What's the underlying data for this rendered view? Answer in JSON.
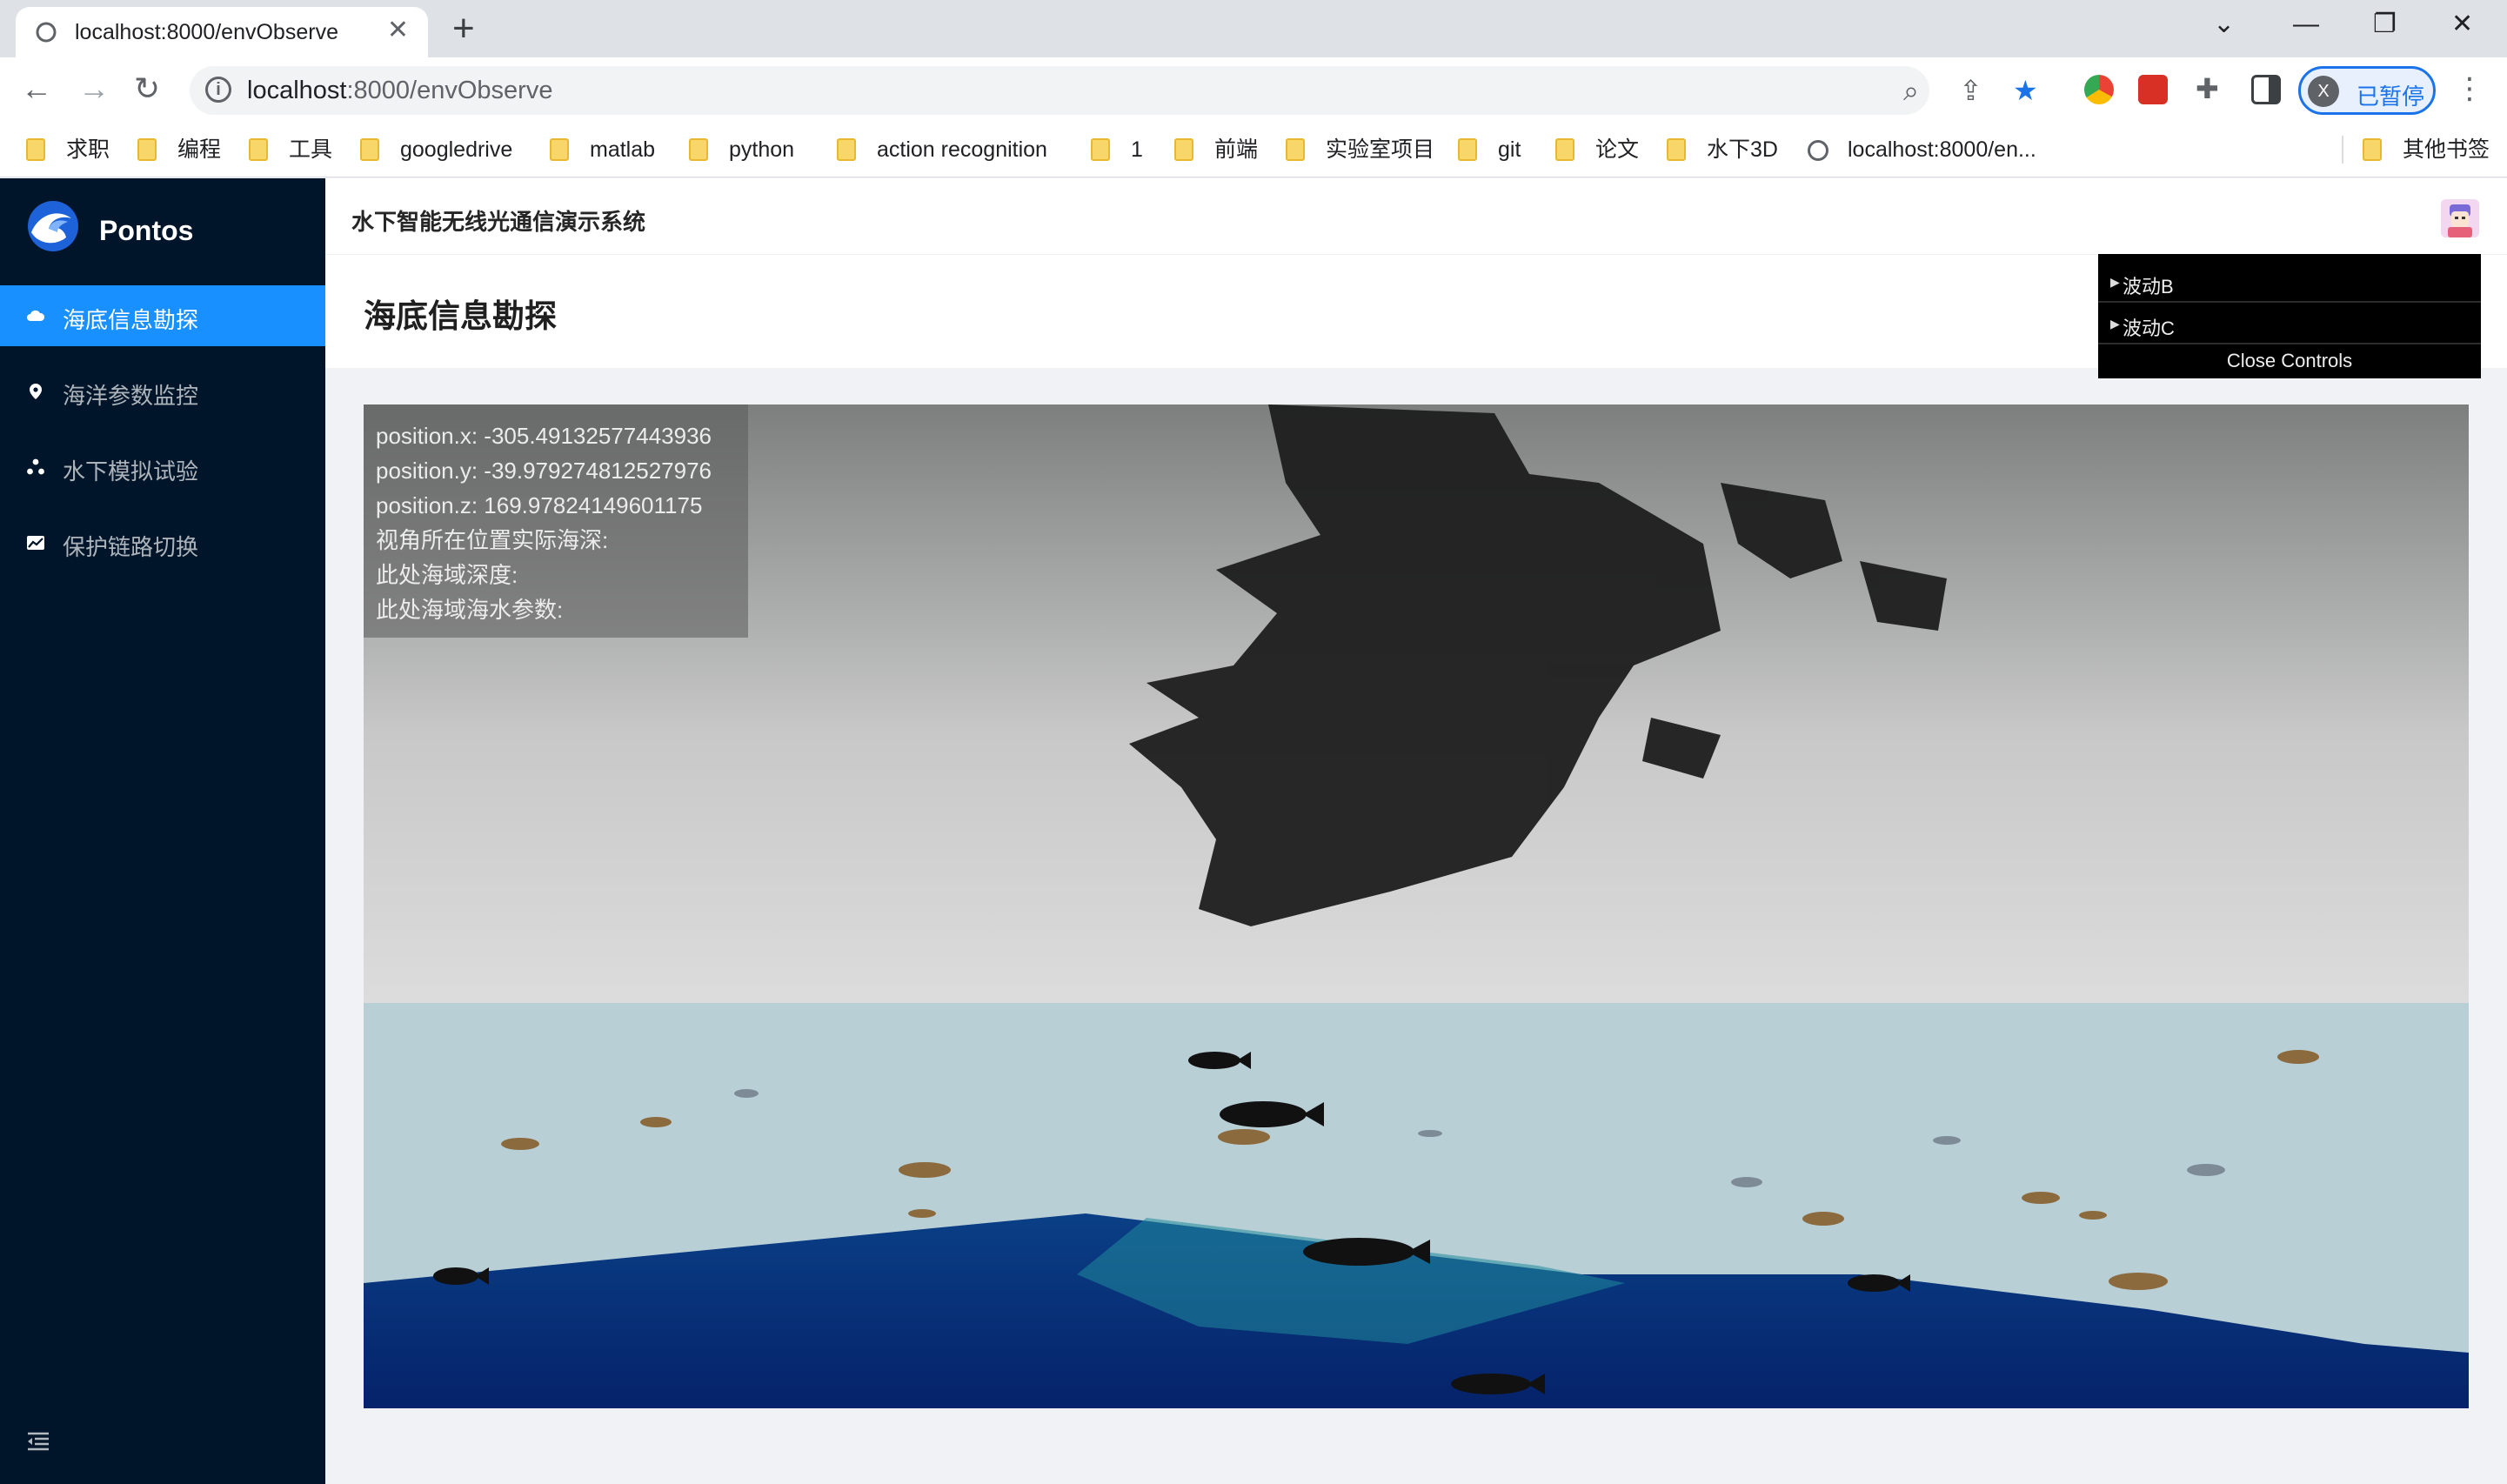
{
  "browser": {
    "tab_title": "localhost:8000/envObserve",
    "url_host": "localhost",
    "url_rest": ":8000/envObserve",
    "profile_initial": "X",
    "profile_label": "已暂停",
    "bookmarks": [
      "求职",
      "编程",
      "工具",
      "googledrive",
      "matlab",
      "python",
      "action recognition",
      "1",
      "前端",
      "实验室项目",
      "git",
      "论文",
      "水下3D",
      "localhost:8000/en...",
      "其他书签"
    ]
  },
  "app": {
    "brand": "Pontos",
    "header_title": "水下智能无线光通信演示系统",
    "page_title": "海底信息勘探",
    "menu": [
      {
        "label": "海底信息勘探",
        "icon": "cloud-icon",
        "active": true
      },
      {
        "label": "海洋参数监控",
        "icon": "location-pin-icon",
        "active": false
      },
      {
        "label": "水下模拟试验",
        "icon": "cluster-icon",
        "active": false
      },
      {
        "label": "保护链路切换",
        "icon": "line-chart-icon",
        "active": false
      }
    ]
  },
  "info": {
    "position_x": "position.x: -305.49132577443936",
    "position_y": "position.y: -39.979274812527976",
    "position_z": "position.z: 169.97824149601175",
    "actual_depth": "视角所在位置实际海深:",
    "sea_depth": "此处海域深度:",
    "water_params": "此处海域海水参数:"
  },
  "controls": {
    "folder_b": "波动B",
    "folder_c": "波动C",
    "close": "Close Controls"
  },
  "colors": {
    "sidebar_bg": "#001529",
    "menu_active": "#1890ff",
    "water": "#b9cfd6",
    "seabed": "#0f3a8a"
  }
}
